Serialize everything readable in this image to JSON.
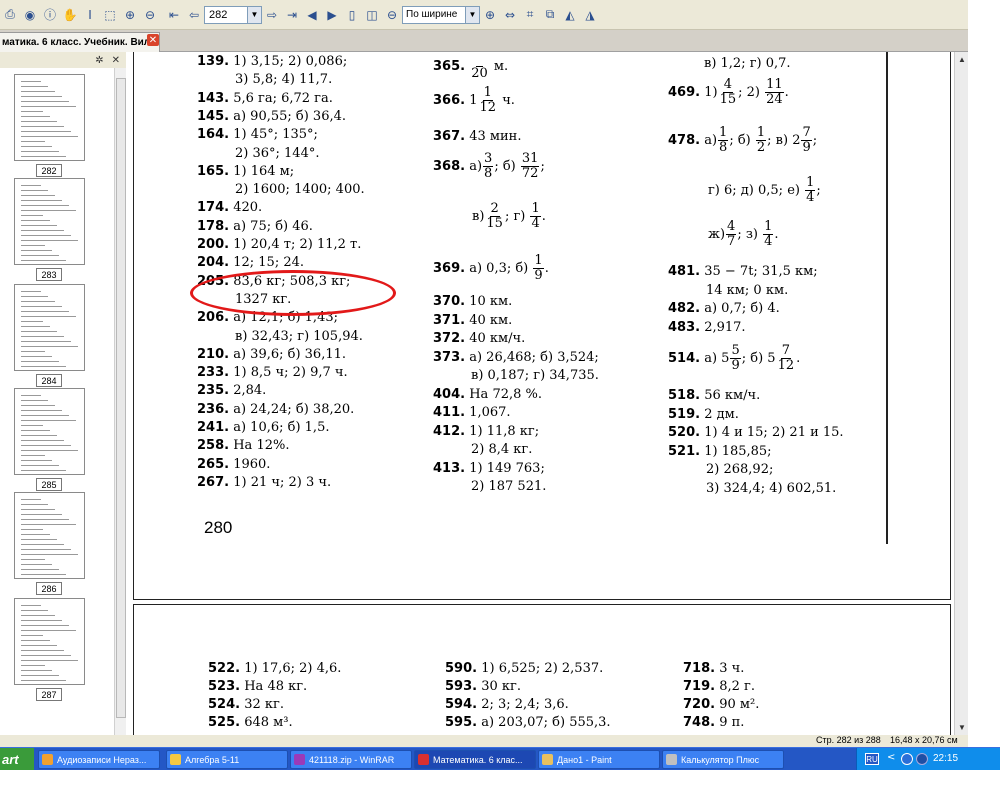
{
  "toolbar": {
    "page_input": "282",
    "zoom_mode": "По ширине"
  },
  "tab": {
    "title": "матика. 6 класс. Учебник. Вил...",
    "close_glyph": "✕"
  },
  "thumbnails": [
    {
      "label": "282"
    },
    {
      "label": "283"
    },
    {
      "label": "284"
    },
    {
      "label": "285"
    },
    {
      "label": "286"
    },
    {
      "label": "287"
    }
  ],
  "page_top": {
    "page_number": "280",
    "col1": [
      {
        "num": "139.",
        "text": "1) 3,15; 2) 0,086;"
      },
      {
        "num": "",
        "text": "3) 5,8; 4) 11,7."
      },
      {
        "num": "143.",
        "text": "5,6 га; 6,72 га."
      },
      {
        "num": "145.",
        "text": "а) 90,55; б) 36,4."
      },
      {
        "num": "164.",
        "text": "1) 45°; 135°;"
      },
      {
        "num": "",
        "text": "2) 36°; 144°."
      },
      {
        "num": "165.",
        "text": "1) 164 м;"
      },
      {
        "num": "",
        "text": "2) 1600; 1400; 400."
      },
      {
        "num": "174.",
        "text": "420."
      },
      {
        "num": "178.",
        "text": "а) 75; б) 46."
      },
      {
        "num": "200.",
        "text": "1) 20,4 т; 2) 11,2 т."
      },
      {
        "num": "204.",
        "text": "12; 15; 24."
      },
      {
        "num": "205.",
        "text": "83,6 кг; 508,3 кг;"
      },
      {
        "num": "",
        "text": "1327 кг."
      },
      {
        "num": "206.",
        "text": "а) 12,1; б) 1,43;"
      },
      {
        "num": "",
        "text": "в) 32,43; г) 105,94."
      },
      {
        "num": "210.",
        "text": "а) 39,6; б) 36,11."
      },
      {
        "num": "233.",
        "text": "1) 8,5 ч; 2) 9,7 ч."
      },
      {
        "num": "235.",
        "text": "2,84."
      },
      {
        "num": "236.",
        "text": "а) 24,24; б) 38,20."
      },
      {
        "num": "241.",
        "text": "а) 10,6; б) 1,5."
      },
      {
        "num": "258.",
        "text": "На 12%."
      },
      {
        "num": "265.",
        "text": "1960."
      },
      {
        "num": "267.",
        "text": "1) 21 ч; 2) 3 ч."
      }
    ],
    "col2": {
      "a365": {
        "num": "365.",
        "den": "20",
        "unit": "м."
      },
      "a366": {
        "num": "366.",
        "whole": "1",
        "fn": "1",
        "fd": "12",
        "unit": "ч."
      },
      "a367": {
        "num": "367.",
        "text": "43 мин."
      },
      "a368": {
        "num": "368.",
        "a": "а)",
        "an": "3",
        "ad": "8",
        "b": "; б)",
        "bn": "31",
        "bd": "72",
        "end": ";",
        "c": "в)",
        "cn": "2",
        "cd": "15",
        "g": "; г)",
        "gn": "1",
        "gd": "4",
        "dot": "."
      },
      "a369": {
        "num": "369.",
        "text": "а) 0,3; б)",
        "fn": "1",
        "fd": "9",
        "dot": "."
      },
      "lines": [
        {
          "num": "370.",
          "text": "10 км."
        },
        {
          "num": "371.",
          "text": "40 км."
        },
        {
          "num": "372.",
          "text": "40 км/ч."
        },
        {
          "num": "373.",
          "text": "а) 26,468; б) 3,524;"
        },
        {
          "num": "",
          "text": "в) 0,187; г) 34,735."
        },
        {
          "num": "404.",
          "text": "На 72,8 %."
        },
        {
          "num": "411.",
          "text": "1,067."
        },
        {
          "num": "412.",
          "text": "1) 11,8 кг;"
        },
        {
          "num": "",
          "text": "2) 8,4 кг."
        },
        {
          "num": "413.",
          "text": "1) 149 763;"
        },
        {
          "num": "",
          "text": "2) 187 521."
        }
      ]
    },
    "col3": {
      "top": "в) 1,2; г) 0,7.",
      "a469": {
        "num": "469.",
        "p1": "1)",
        "n1": "4",
        "d1": "15",
        "p2": "; 2)",
        "n2": "11",
        "d2": "24",
        "dot": "."
      },
      "a478": {
        "num": "478.",
        "p1": "а)",
        "n1": "1",
        "d1": "8",
        "p2": "; б)",
        "n2": "1",
        "d2": "2",
        "p3": "; в) 2",
        "n3": "7",
        "d3": "9",
        "end": ";"
      },
      "a478b": {
        "text": "г) 6; д) 0,5; е)",
        "n": "1",
        "d": "4",
        "end": ";"
      },
      "a478c": {
        "p1": "ж)",
        "n1": "4",
        "d1": "7",
        "p2": "; з)",
        "n2": "1",
        "d2": "4",
        "dot": "."
      },
      "lines_a": [
        {
          "num": "481.",
          "text": "35 − 7t; 31,5 км;"
        },
        {
          "num": "",
          "text": "14 км; 0 км."
        },
        {
          "num": "482.",
          "text": "а) 0,7; б) 4."
        },
        {
          "num": "483.",
          "text": "2,917."
        }
      ],
      "a514": {
        "num": "514.",
        "p1": "а) 5",
        "n1": "5",
        "d1": "9",
        "p2": "; б) 5",
        "n2": "7",
        "d2": "12",
        "dot": "."
      },
      "lines_b": [
        {
          "num": "518.",
          "text": "56 км/ч."
        },
        {
          "num": "519.",
          "text": "2 дм."
        },
        {
          "num": "520.",
          "text": "1) 4 и 15; 2) 21 и 15."
        },
        {
          "num": "521.",
          "text": "1) 185,85;"
        },
        {
          "num": "",
          "text": "2) 268,92;"
        },
        {
          "num": "",
          "text": "3) 324,4; 4) 602,51."
        }
      ]
    }
  },
  "page_bottom": {
    "col1": [
      {
        "num": "522.",
        "text": "1) 17,6; 2) 4,6."
      },
      {
        "num": "523.",
        "text": "На 48 кг."
      },
      {
        "num": "524.",
        "text": "32 кг."
      },
      {
        "num": "525.",
        "text": "648 м³."
      }
    ],
    "col2": [
      {
        "num": "590.",
        "text": "1) 6,525; 2) 2,537."
      },
      {
        "num": "593.",
        "text": "30 кг."
      },
      {
        "num": "594.",
        "text": "2; 3; 2,4; 3,6."
      },
      {
        "num": "595.",
        "text": "а) 203,07; б) 555,3."
      }
    ],
    "col3": [
      {
        "num": "718.",
        "text": "3 ч."
      },
      {
        "num": "719.",
        "text": "8,2 г."
      },
      {
        "num": "720.",
        "text": "90 м²."
      },
      {
        "num": "748.",
        "text": "9 п."
      }
    ]
  },
  "status": {
    "page": "Стр. 282 из 288",
    "size": "16,48 x 20,76 см"
  },
  "taskbar": {
    "start": "art",
    "items": [
      {
        "label": "Аудиозаписи Нераз...",
        "icon_color": "#f0a030"
      },
      {
        "label": "Алгебра 5-11",
        "icon_color": "#f5c842"
      },
      {
        "label": "421118.zip - WinRAR",
        "icon_color": "#9b3ab8"
      },
      {
        "label": "Математика. 6 клас...",
        "icon_color": "#d83030"
      },
      {
        "label": "Дано1 - Paint",
        "icon_color": "#e8c060"
      },
      {
        "label": "Калькулятор Плюс",
        "icon_color": "#c0c0c0"
      }
    ],
    "lang": "RU",
    "tray_arrow": "<",
    "clock": "22:15"
  },
  "colors": {
    "annotation": "#e21919",
    "taskbar": "#2457c5",
    "tray": "#0f8deb"
  }
}
